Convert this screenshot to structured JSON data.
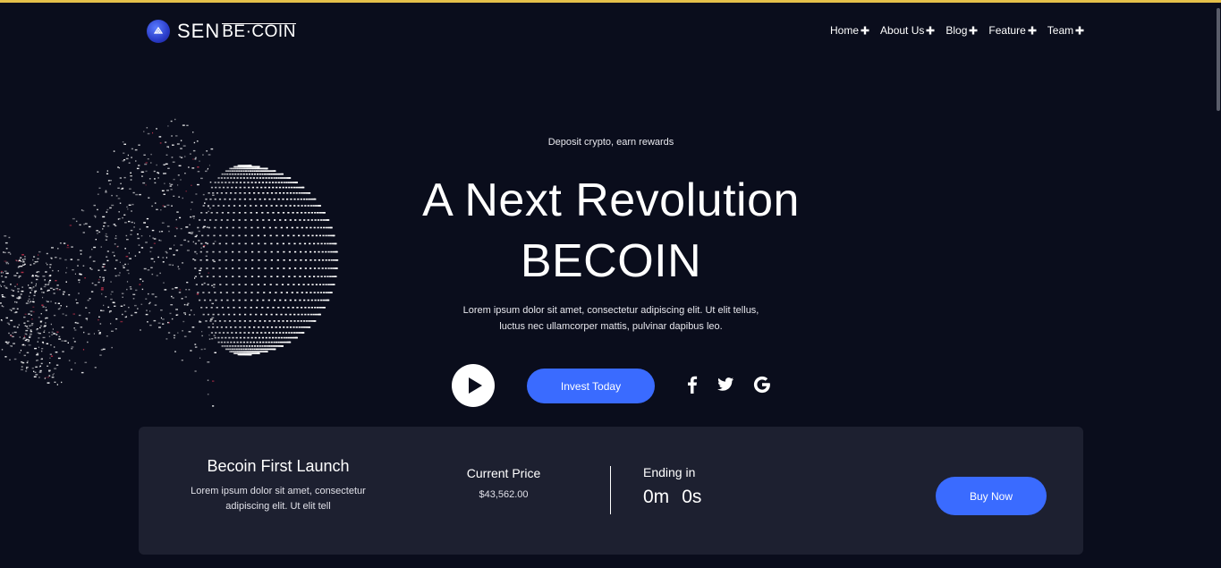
{
  "brand": {
    "name_part1": "SEN",
    "name_part2": "BE·COIN"
  },
  "nav": {
    "items": [
      {
        "label": "Home"
      },
      {
        "label": "About Us"
      },
      {
        "label": "Blog"
      },
      {
        "label": "Feature"
      },
      {
        "label": "Team"
      }
    ]
  },
  "hero": {
    "kicker": "Deposit crypto, earn rewards",
    "title_line1": "A Next Revolution",
    "title_line2": "BECOIN",
    "description_line1": "Lorem ipsum dolor sit amet, consectetur adipiscing elit. Ut elit tellus,",
    "description_line2": "luctus nec ullamcorper mattis, pulvinar dapibus leo.",
    "invest_label": "Invest Today",
    "play_icon": "play-icon",
    "socials": [
      "facebook-icon",
      "twitter-icon",
      "google-icon"
    ]
  },
  "launch": {
    "title": "Becoin First Launch",
    "description_line1": "Lorem ipsum dolor sit amet, consectetur",
    "description_line2": "adipiscing elit. Ut elit tell",
    "price_label": "Current Price",
    "price_value": "$43,562.00",
    "ending_label": "Ending in",
    "minutes": "0m",
    "seconds": "0s",
    "buy_label": "Buy Now"
  },
  "colors": {
    "background": "#0a0d1c",
    "panel": "#1d2030",
    "accent_blue": "#3a6bff",
    "top_border": "#e5c04a"
  }
}
